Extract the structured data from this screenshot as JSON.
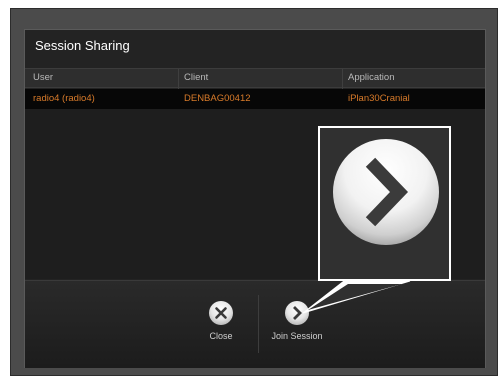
{
  "dialog": {
    "title": "Session Sharing",
    "columns": [
      "User",
      "Client",
      "Application"
    ],
    "rows": [
      {
        "user": "radio4 (radio4)",
        "client": "DENBAG00412",
        "application": "iPlan30Cranial"
      }
    ],
    "actions": {
      "close_label": "Close",
      "join_label": "Join Session"
    }
  },
  "icons": {
    "close": "close-icon",
    "join": "chevron-right-icon",
    "zoom": "chevron-right-icon"
  },
  "colors": {
    "accent_text": "#d97b2a",
    "header_text": "#b9b9b9",
    "title_text": "#ffffff"
  }
}
